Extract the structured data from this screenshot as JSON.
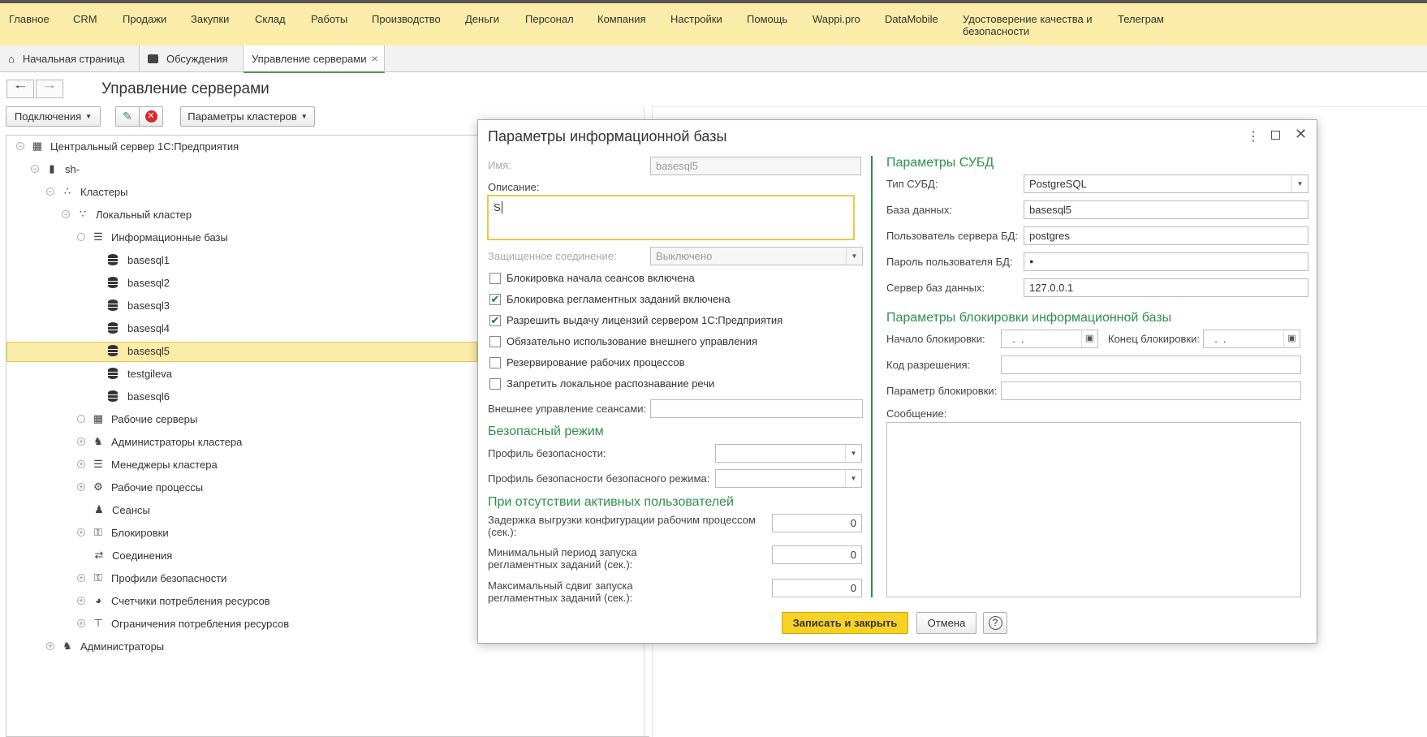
{
  "menu": [
    "Главное",
    "CRM",
    "Продажи",
    "Закупки",
    "Склад",
    "Работы",
    "Производство",
    "Деньги",
    "Персонал",
    "Компания",
    "Настройки",
    "Помощь",
    "Wappi.pro",
    "DataMobile",
    "Удостоверение качества и безопасности",
    "Телеграм"
  ],
  "tabs": [
    {
      "label": "Начальная страница",
      "icon": "home-icon"
    },
    {
      "label": "Обсуждения",
      "icon": "chat-icon"
    },
    {
      "label": "Управление серверами",
      "close": "×"
    }
  ],
  "page": {
    "title": "Управление серверами"
  },
  "toolbar": {
    "connections_label": "Подключения",
    "cluster_params_label": "Параметры кластеров"
  },
  "tree": {
    "root": "Центральный сервер 1С:Предприятия",
    "server": "sh-",
    "clusters": "Кластеры",
    "local_cluster": "Локальный кластер",
    "infobases": "Информационные базы",
    "bases": [
      "basesql1",
      "basesql2",
      "basesql3",
      "basesql4",
      "basesql5",
      "testgileva",
      "basesql6"
    ],
    "work_servers": "Рабочие серверы",
    "cluster_admins": "Администраторы кластера",
    "cluster_managers": "Менеджеры кластера",
    "work_processes": "Рабочие процессы",
    "sessions": "Сеансы",
    "locks": "Блокировки",
    "connections": "Соединения",
    "security_profiles": "Профили безопасности",
    "resource_counters": "Счетчики потребления ресурсов",
    "resource_limits": "Ограничения потребления ресурсов",
    "admins": "Администраторы"
  },
  "dialog": {
    "title": "Параметры информационной базы",
    "name_label": "Имя:",
    "name_value": "basesql5",
    "description_label": "Описание:",
    "description_value": "S",
    "secure_label": "Защищенное соединение:",
    "secure_value": "Выключено",
    "checkboxes": [
      {
        "label": "Блокировка начала сеансов включена",
        "checked": false
      },
      {
        "label": "Блокировка регламентных заданий включена",
        "checked": true
      },
      {
        "label": "Разрешить выдачу лицензий сервером 1С:Предприятия",
        "checked": true
      },
      {
        "label": "Обязательно использование внешнего управления",
        "checked": false
      },
      {
        "label": "Резервирование рабочих процессов",
        "checked": false
      },
      {
        "label": "Запретить локальное распознавание речи",
        "checked": false
      }
    ],
    "ext_mgmt_label": "Внешнее управление сеансами:",
    "safe_mode_header": "Безопасный режим",
    "sec_profile_label": "Профиль безопасности:",
    "safe_profile_label": "Профиль безопасности безопасного режима:",
    "no_users_header": "При отсутствии активных пользователей",
    "delay_label": "Задержка выгрузки конфигурации рабочим процессом (сек.):",
    "delay_value": "0",
    "min_period_label": "Минимальный период запуска регламентных заданий (сек.):",
    "min_period_value": "0",
    "max_shift_label": "Максимальный сдвиг запуска регламентных заданий (сек.):",
    "max_shift_value": "0",
    "dbms_header": "Параметры СУБД",
    "dbms_type_label": "Тип СУБД:",
    "dbms_type_value": "PostgreSQL",
    "db_label": "База данных:",
    "db_value": "basesql5",
    "db_user_label": "Пользователь сервера БД:",
    "db_user_value": "postgres",
    "db_pass_label": "Пароль пользователя БД:",
    "db_pass_value": "●",
    "db_server_label": "Сервер баз данных:",
    "db_server_value": "127.0.0.1",
    "lock_header": "Параметры блокировки информационной базы",
    "lock_start_label": "Начало блокировки:",
    "lock_start_value": "  .  .",
    "lock_end_label": "Конец блокировки:",
    "lock_end_value": "  .  .",
    "perm_code_label": "Код разрешения:",
    "lock_param_label": "Параметр блокировки:",
    "message_label": "Сообщение:",
    "save_label": "Записать и закрыть",
    "cancel_label": "Отмена",
    "help_label": "?"
  },
  "colors": {
    "menubar": "#fbeca9",
    "accent_green": "#2e8f4a",
    "primary_button": "#f7d226"
  }
}
